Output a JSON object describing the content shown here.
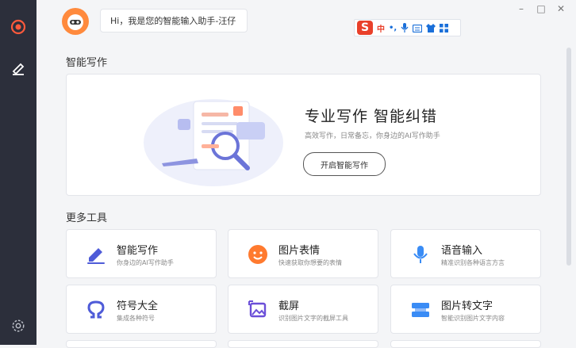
{
  "window": {
    "minimize": "–",
    "maximize": "□",
    "close": "✕"
  },
  "assistant": {
    "greeting": "Hi，我是您的智能输入助手-汪仔"
  },
  "ime_toolbar": {
    "logo": "S",
    "mode": "中",
    "punct": "•,",
    "icons": [
      "mic-icon",
      "keyboard-icon",
      "skin-icon",
      "toolbox-icon"
    ]
  },
  "sections": {
    "smart_writing": "智能写作",
    "more_tools": "更多工具"
  },
  "hero": {
    "title": "专业写作 智能纠错",
    "subtitle": "高效写作，日常备忘，你身边的AI写作助手",
    "button": "开启智能写作",
    "doc_badge": "纠"
  },
  "tools": [
    {
      "title": "智能写作",
      "desc": "你身边的AI写作助手",
      "icon": "pen-icon",
      "color": "#4e5bd8"
    },
    {
      "title": "图片表情",
      "desc": "快速获取你想要的表情",
      "icon": "emoji-icon",
      "color": "#ff7a2f"
    },
    {
      "title": "语音输入",
      "desc": "精准识别各种语言方言",
      "icon": "microphone-icon",
      "color": "#3a8cf5"
    },
    {
      "title": "符号大全",
      "desc": "集成各种符号",
      "icon": "omega-icon",
      "color": "#4e5bd8"
    },
    {
      "title": "截屏",
      "desc": "识别图片文字的截屏工具",
      "icon": "screenshot-icon",
      "color": "#6b4fd8"
    },
    {
      "title": "图片转文字",
      "desc": "智能识别图片文字内容",
      "icon": "image-to-text-icon",
      "color": "#3a8cf5"
    }
  ]
}
